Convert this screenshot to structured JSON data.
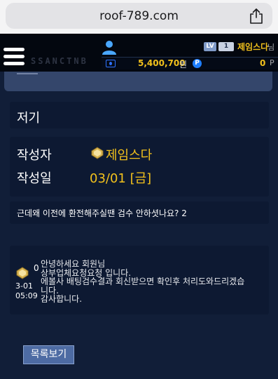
{
  "browser": {
    "url": "roof-789.com",
    "share_icon": "share-icon"
  },
  "header": {
    "logo_text": "SSANCTNB",
    "menu_icon": "hamburger-menu-icon",
    "user": {
      "level_badge": "LV",
      "level_value": "1",
      "name": "제임스다",
      "name_suffix": "님",
      "money": "5,400,700",
      "money_unit": "원",
      "point_badge": "P",
      "points": "0",
      "points_unit": "P"
    }
  },
  "post": {
    "title": "저기",
    "author_label": "작성자",
    "author": "제임스다",
    "date_label": "작성일",
    "date": "03/01 [금]",
    "question": "근데왜 이전에 환전해주실땐 검수 안하셧나요? 2"
  },
  "reply": {
    "number": "0",
    "date_line1": "3-01",
    "date_line2": "05:09",
    "lines": [
      "안녕하세요 회원님",
      "상부업체요청요청 입니다.",
      "에볼사 배팅검수결과 회신받으면 확인후 처리도와드리겠습",
      "니다.",
      "감사합니다."
    ]
  },
  "actions": {
    "list_button": "목록보기"
  },
  "colors": {
    "accent_gold": "#f2c11c",
    "background": "#111e38",
    "header_bg": "#03070f",
    "button_bg": "#4d6ba3"
  }
}
